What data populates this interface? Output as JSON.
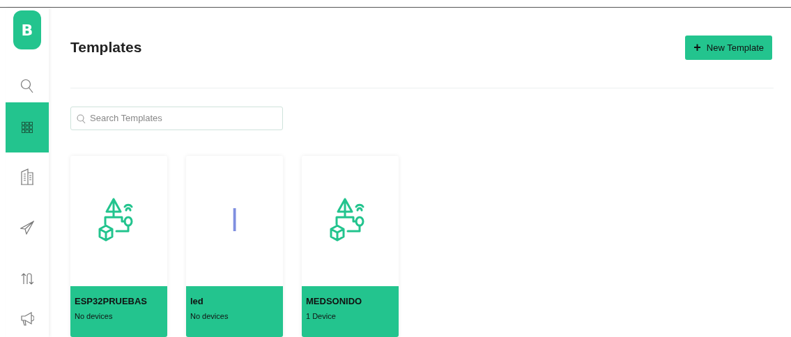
{
  "sidebar": {
    "logo": "B",
    "items": [
      {
        "kind": "search",
        "selected": false
      },
      {
        "kind": "grid",
        "selected": true
      },
      {
        "kind": "building",
        "selected": false
      },
      {
        "kind": "send",
        "selected": false
      },
      {
        "kind": "arrows",
        "selected": false
      },
      {
        "kind": "megaphone",
        "selected": false
      }
    ]
  },
  "header": {
    "title": "Templates",
    "button": {
      "icon": "+",
      "label": "New Template"
    }
  },
  "search": {
    "placeholder": "Search Templates"
  },
  "templates": [
    {
      "kind": "icon",
      "name": "ESP32PRUEBAS",
      "devices": "No devices"
    },
    {
      "kind": "letter",
      "letter": "l",
      "name": "led",
      "devices": "No devices"
    },
    {
      "kind": "icon",
      "name": "MEDSONIDO",
      "devices": "1 Device"
    }
  ]
}
